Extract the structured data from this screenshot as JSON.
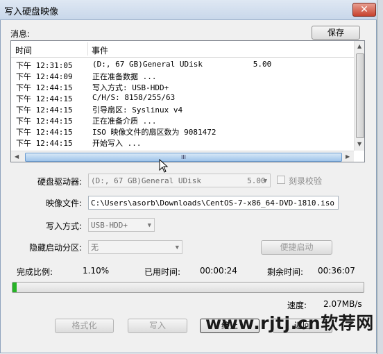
{
  "window": {
    "title": "写入硬盘映像",
    "close_symbol": "✕"
  },
  "log": {
    "section_label": "消息:",
    "save_button": "保存",
    "columns": [
      "时间",
      "事件"
    ],
    "rows": [
      {
        "time": "下午 12:31:05",
        "event": "(D:, 67 GB)General UDisk           5.00"
      },
      {
        "time": "下午 12:44:09",
        "event": "正在准备数据 ..."
      },
      {
        "time": "下午 12:44:15",
        "event": "写入方式: USB-HDD+"
      },
      {
        "time": "下午 12:44:15",
        "event": "C/H/S: 8158/255/63"
      },
      {
        "time": "下午 12:44:15",
        "event": "引导扇区: Syslinux v4"
      },
      {
        "time": "下午 12:44:15",
        "event": "正在准备介质 ..."
      },
      {
        "time": "下午 12:44:15",
        "event": "ISO 映像文件的扇区数为 9081472"
      },
      {
        "time": "下午 12:44:15",
        "event": "开始写入 ..."
      }
    ],
    "hscroll_grip": "III"
  },
  "form": {
    "drive_label": "硬盘驱动器:",
    "drive_value": "(D:, 67 GB)General UDisk          5.00",
    "verify_label": "刻录校验",
    "image_label": "映像文件:",
    "image_value": "C:\\Users\\asorb\\Downloads\\CentOS-7-x86_64-DVD-1810.iso",
    "write_mode_label": "写入方式:",
    "write_mode_value": "USB-HDD+",
    "hidden_partition_label": "隐藏启动分区:",
    "hidden_partition_value": "无",
    "quick_boot_button": "便捷启动"
  },
  "status": {
    "progress_label": "完成比例:",
    "progress_value": "1.10%",
    "progress_fraction": 0.011,
    "elapsed_label": "已用时间:",
    "elapsed_value": "00:00:24",
    "remaining_label": "剩余时间:",
    "remaining_value": "00:36:07",
    "speed_label": "速度:",
    "speed_value": "2.07MB/s"
  },
  "buttons": {
    "format": "格式化",
    "write": "写入",
    "stop": "终止",
    "back": "返回"
  },
  "watermark": "www.rjtj.cn软荐网",
  "colors": {
    "progress": "#25b325",
    "close": "#c7422e",
    "title_bar": "#c8d7ea"
  }
}
